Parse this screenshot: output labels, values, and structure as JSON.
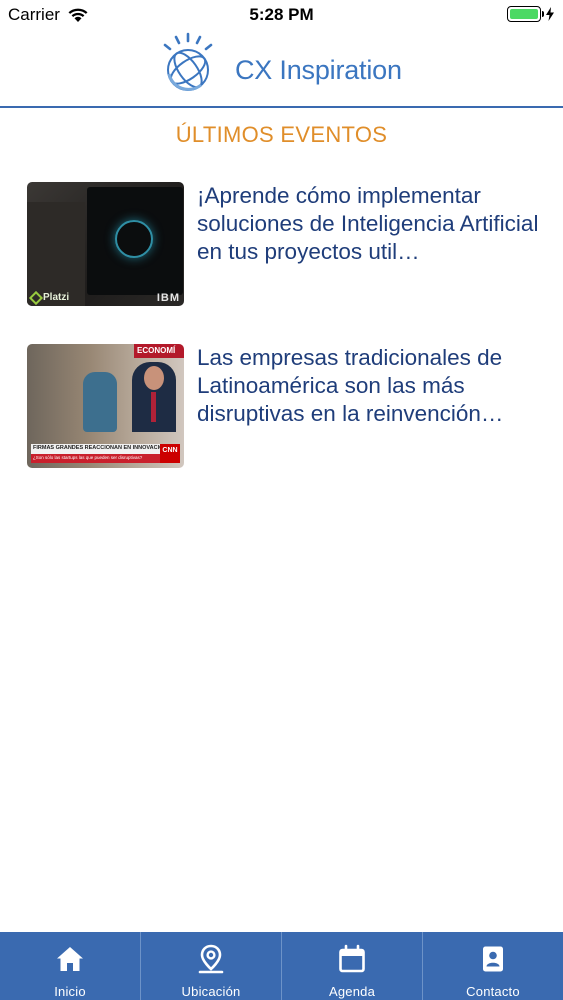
{
  "status_bar": {
    "carrier": "Carrier",
    "time": "5:28 PM",
    "battery_color": "#4cd964"
  },
  "header": {
    "brand": "CX Inspiration",
    "logo_icon": "ibm-globe-logo-icon",
    "accent_color": "#3a6ab0"
  },
  "section": {
    "title": "ÚLTIMOS EVENTOS",
    "title_color": "#e08e2a"
  },
  "news": [
    {
      "title": "¡Aprende cómo implementar soluciones de Inteligencia Artificial en tus proyectos util…",
      "meta": "",
      "thumb_brand_left": "Platzi",
      "thumb_brand_right": "IBM"
    },
    {
      "title": "Las empresas tradicionales de Latinoamérica son las más disruptivas en la reinvención…",
      "meta": "",
      "thumb_banner": "FIRMAS GRANDES REACCIONAN EN INNOVACIÓN",
      "thumb_sub": "¿Son sólo las startups las que pueden ser disruptivas?",
      "thumb_network": "CNN",
      "thumb_section": "ECONOMÍ"
    }
  ],
  "tabs": [
    {
      "label": "Inicio",
      "icon": "home-icon"
    },
    {
      "label": "Ubicación",
      "icon": "location-pin-icon"
    },
    {
      "label": "Agenda",
      "icon": "calendar-icon"
    },
    {
      "label": "Contacto",
      "icon": "contact-card-icon"
    }
  ]
}
